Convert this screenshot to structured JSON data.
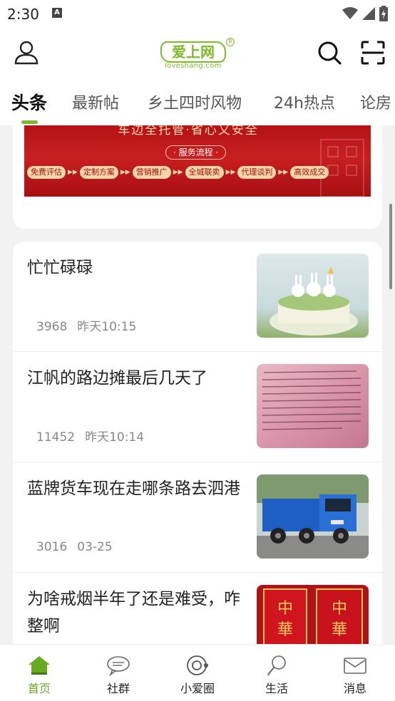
{
  "status_bar": {
    "time": "2:30",
    "notification_icon": "a-icon",
    "icons": [
      "wifi-icon",
      "signal-icon",
      "battery-icon"
    ]
  },
  "header": {
    "logo_text": "爱上网",
    "logo_sub": "loveshang.com",
    "logo_registered": "R",
    "icons": [
      "user-icon",
      "search-icon",
      "scan-icon"
    ]
  },
  "tabs": [
    {
      "label": "头条",
      "active": true
    },
    {
      "label": "最新帖",
      "active": false
    },
    {
      "label": "乡土四时风物",
      "active": false
    },
    {
      "label": "24h热点",
      "active": false
    },
    {
      "label": "论房",
      "active": false
    }
  ],
  "banner": {
    "top_text": "车边全托管·省心又安全",
    "flow_label": "· 服务流程 ·",
    "steps": [
      "免费评估",
      "定制方案",
      "营销推广",
      "全城联卖",
      "代理谈判",
      "高效成交"
    ]
  },
  "feed": [
    {
      "title": "忙忙碌碌",
      "views": "3968",
      "time": "昨天10:15",
      "thumb": "cake-photo"
    },
    {
      "title": "江帆的路边摊最后几天了",
      "views": "11452",
      "time": "昨天10:14",
      "thumb": "document-photo"
    },
    {
      "title": "蓝牌货车现在走哪条路去泗港",
      "views": "3016",
      "time": "03-25",
      "thumb": "truck-photo"
    },
    {
      "title": "为啥戒烟半年了还是难受，咋整啊",
      "views": "",
      "time": "",
      "thumb": "cigarette-photo"
    }
  ],
  "bottom_nav": [
    {
      "label": "首页",
      "icon": "home-icon",
      "active": true
    },
    {
      "label": "社群",
      "icon": "chat-icon",
      "active": false
    },
    {
      "label": "小爱圈",
      "icon": "circle-icon",
      "active": false
    },
    {
      "label": "生活",
      "icon": "magnifier-icon",
      "active": false
    },
    {
      "label": "消息",
      "icon": "mail-icon",
      "active": false
    }
  ],
  "colors": {
    "accent": "#7cba2a",
    "banner_red": "#b51316",
    "text_secondary": "#888888"
  }
}
